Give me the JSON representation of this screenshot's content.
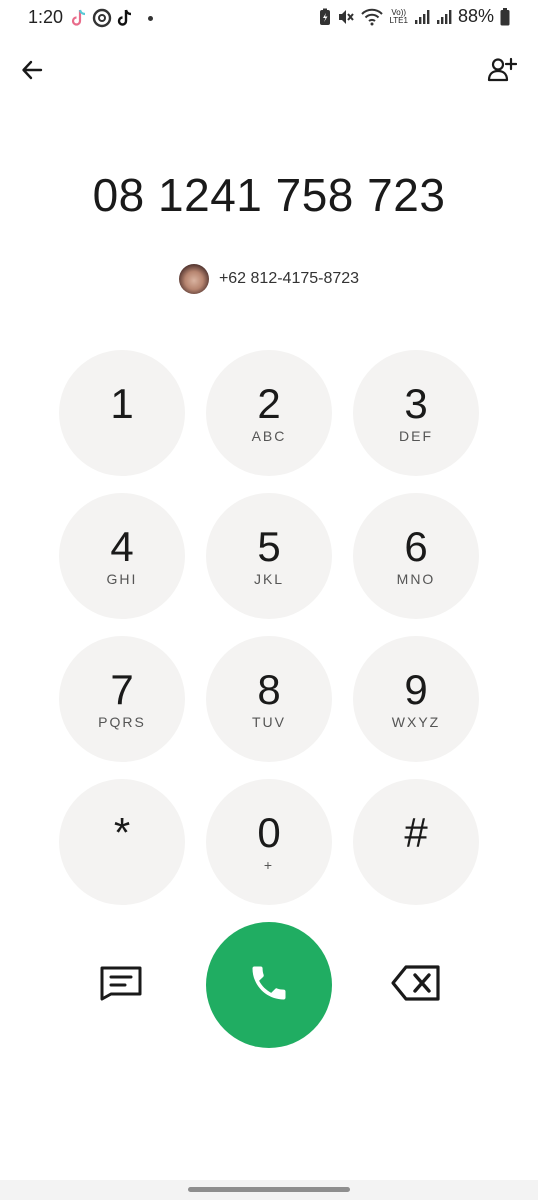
{
  "status_bar": {
    "time": "1:20",
    "battery": "88%",
    "network_label_top": "Vo))",
    "network_label_bottom": "LTE1",
    "left_icons": [
      "tiktok-icon",
      "threads-icon",
      "tiktok-icon",
      "notification-dot"
    ],
    "right_icons": [
      "battery-saver-icon",
      "mute-icon",
      "wifi-icon",
      "signal-icon",
      "signal-icon",
      "battery-icon"
    ]
  },
  "top_bar": {
    "back_icon": "back-arrow-icon",
    "add_contact_icon": "add-contact-icon"
  },
  "dialer": {
    "number": "08 1241 758 723",
    "suggestion": {
      "number": "+62 812-4175-8723"
    }
  },
  "keypad": {
    "keys": [
      {
        "digit": "1",
        "letters": ""
      },
      {
        "digit": "2",
        "letters": "ABC"
      },
      {
        "digit": "3",
        "letters": "DEF"
      },
      {
        "digit": "4",
        "letters": "GHI"
      },
      {
        "digit": "5",
        "letters": "JKL"
      },
      {
        "digit": "6",
        "letters": "MNO"
      },
      {
        "digit": "7",
        "letters": "PQRS"
      },
      {
        "digit": "8",
        "letters": "TUV"
      },
      {
        "digit": "9",
        "letters": "WXYZ"
      },
      {
        "digit": "*",
        "letters": ""
      },
      {
        "digit": "0",
        "letters": "+"
      },
      {
        "digit": "#",
        "letters": ""
      }
    ]
  },
  "actions": {
    "message_icon": "message-icon",
    "call_icon": "phone-icon",
    "backspace_icon": "backspace-icon",
    "call_color": "#20ad62"
  },
  "colors": {
    "key_background": "#f4f3f2",
    "text": "#1a1a1a"
  }
}
